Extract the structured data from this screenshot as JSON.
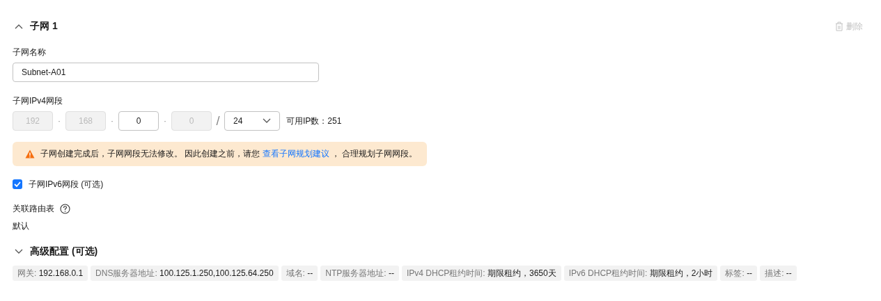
{
  "section": {
    "title": "子网 1",
    "expanded": true,
    "delete": {
      "label": "删除",
      "disabled": true
    }
  },
  "name_field": {
    "label": "子网名称",
    "value": "Subnet-A01"
  },
  "ipv4": {
    "label": "子网IPv4网段",
    "octets": [
      {
        "value": "192",
        "disabled": true
      },
      {
        "value": "168",
        "disabled": true
      },
      {
        "value": "0",
        "disabled": false
      },
      {
        "value": "0",
        "disabled": true
      }
    ],
    "separators": [
      "·",
      "·",
      "·",
      "/"
    ],
    "mask": "24",
    "available": "可用IP数：251"
  },
  "warning": {
    "text": "子网创建完成后，子网网段无法修改。 因此创建之前，请您",
    "link": "查看子网规划建议",
    "after": "， 合理规划子网网段。"
  },
  "ipv6": {
    "label": "子网IPv6网段 (可选)",
    "checked": true
  },
  "route_table": {
    "label": "关联路由表",
    "value": "默认"
  },
  "advanced": {
    "title": "高级配置 (可选)",
    "expanded": false
  },
  "tags": [
    {
      "label": "网关:",
      "value": "192.168.0.1"
    },
    {
      "label": "DNS服务器地址:",
      "value": "100.125.1.250,100.125.64.250"
    },
    {
      "label": "域名:",
      "value": "--"
    },
    {
      "label": "NTP服务器地址:",
      "value": "--"
    },
    {
      "label": "IPv4 DHCP租约时间:",
      "value": "期限租约，3650天"
    },
    {
      "label": "IPv6 DHCP租约时间:",
      "value": "期限租约，2小时"
    },
    {
      "label": "标签:",
      "value": "--"
    },
    {
      "label": "描述:",
      "value": "--"
    }
  ]
}
